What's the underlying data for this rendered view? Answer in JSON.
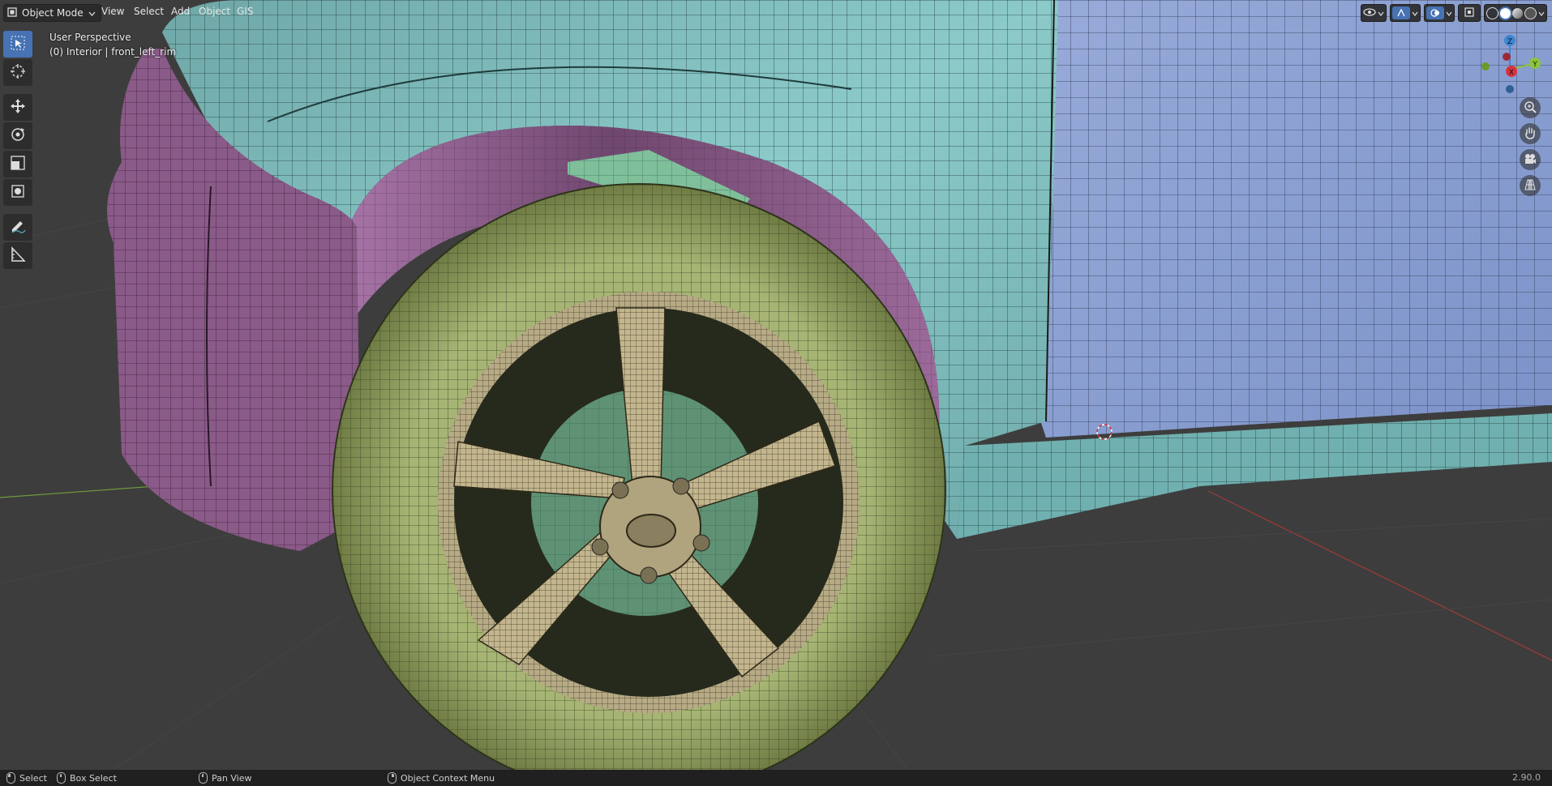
{
  "header": {
    "mode_label": "Object Mode",
    "menus": [
      "View",
      "Select",
      "Add",
      "Object",
      "GIS"
    ]
  },
  "viewport": {
    "perspective_label": "User Perspective",
    "object_label": "(0) Interior | front_left_rim"
  },
  "toolbar": {
    "tools": [
      "select-box-tool",
      "cursor-tool",
      "move-tool",
      "rotate-tool",
      "scale-tool",
      "transform-tool",
      "annotate-tool",
      "measure-tool"
    ],
    "active": "select-box-tool"
  },
  "gizmo": {
    "axes": [
      "Z",
      "X",
      "Y"
    ],
    "colors": {
      "x": "#d9323f",
      "y": "#8cc43c",
      "z": "#3d86d4"
    }
  },
  "statusbar": {
    "select": "Select",
    "box_select": "Box Select",
    "pan_view": "Pan View",
    "context_menu": "Object Context Menu",
    "version": "2.90.0"
  },
  "colors": {
    "background": "#3d3d3d",
    "accent": "#4772b3",
    "body_teal": "#7fbcbc",
    "door_blue": "#8aa2d6",
    "bumper_purple": "#8a5a88",
    "tire_green": "#9aaa6a",
    "rim_tan": "#b7ab86",
    "disc_green": "#5f9274"
  }
}
